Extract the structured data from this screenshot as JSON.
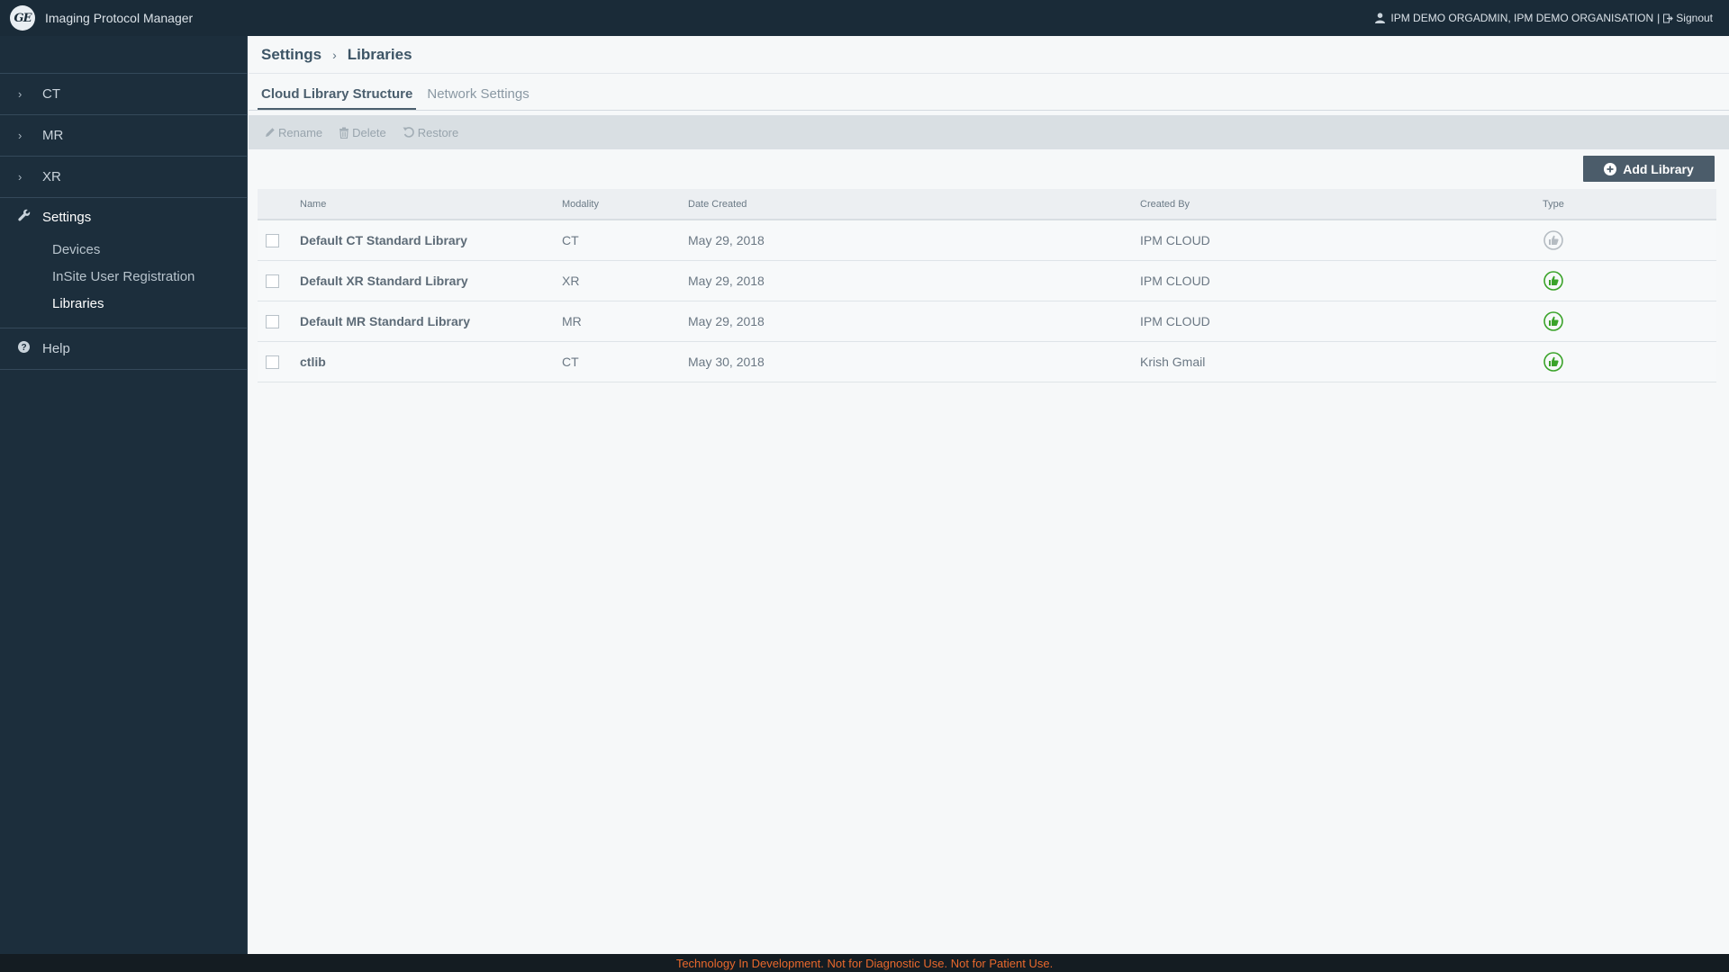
{
  "app": {
    "logo_text": "GE",
    "title": "Imaging Protocol Manager"
  },
  "user": {
    "name": "IPM DEMO ORGADMIN, IPM DEMO ORGANISATION",
    "separator": "|",
    "signout_label": "Signout"
  },
  "sidebar": {
    "items": [
      {
        "label": "CT",
        "icon": "chevron-right-icon"
      },
      {
        "label": "MR",
        "icon": "chevron-right-icon"
      },
      {
        "label": "XR",
        "icon": "chevron-right-icon"
      }
    ],
    "settings": {
      "label": "Settings",
      "icon": "wrench-icon",
      "children": [
        {
          "label": "Devices",
          "active": false
        },
        {
          "label": "InSite User Registration",
          "active": false
        },
        {
          "label": "Libraries",
          "active": true
        }
      ]
    },
    "help": {
      "label": "Help",
      "icon": "question-circle-icon"
    }
  },
  "breadcrumb": {
    "parent": "Settings",
    "separator": "›",
    "current": "Libraries"
  },
  "tabs": [
    {
      "label": "Cloud Library Structure",
      "active": true
    },
    {
      "label": "Network Settings",
      "active": false
    }
  ],
  "toolbar": {
    "rename_label": "Rename",
    "delete_label": "Delete",
    "restore_label": "Restore"
  },
  "add_button_label": "Add Library",
  "table": {
    "columns": [
      "Name",
      "Modality",
      "Date Created",
      "Created By",
      "Type"
    ],
    "rows": [
      {
        "name": "Default CT Standard Library",
        "modality": "CT",
        "date": "May 29, 2018",
        "created_by": "IPM CLOUD",
        "type_status": "inactive"
      },
      {
        "name": "Default XR Standard Library",
        "modality": "XR",
        "date": "May 29, 2018",
        "created_by": "IPM CLOUD",
        "type_status": "active"
      },
      {
        "name": "Default MR Standard Library",
        "modality": "MR",
        "date": "May 29, 2018",
        "created_by": "IPM CLOUD",
        "type_status": "active"
      },
      {
        "name": "ctlib",
        "modality": "CT",
        "date": "May 30, 2018",
        "created_by": "Krish Gmail",
        "type_status": "active"
      }
    ]
  },
  "footer_text": "Technology In Development. Not for Diagnostic Use. Not for Patient Use.",
  "colors": {
    "topbar": "#1a2b38",
    "sidebar": "#1c2e3c",
    "accent_green": "#3aa329",
    "inactive_gray": "#b5bcc2",
    "footer_text": "#e8682c"
  }
}
